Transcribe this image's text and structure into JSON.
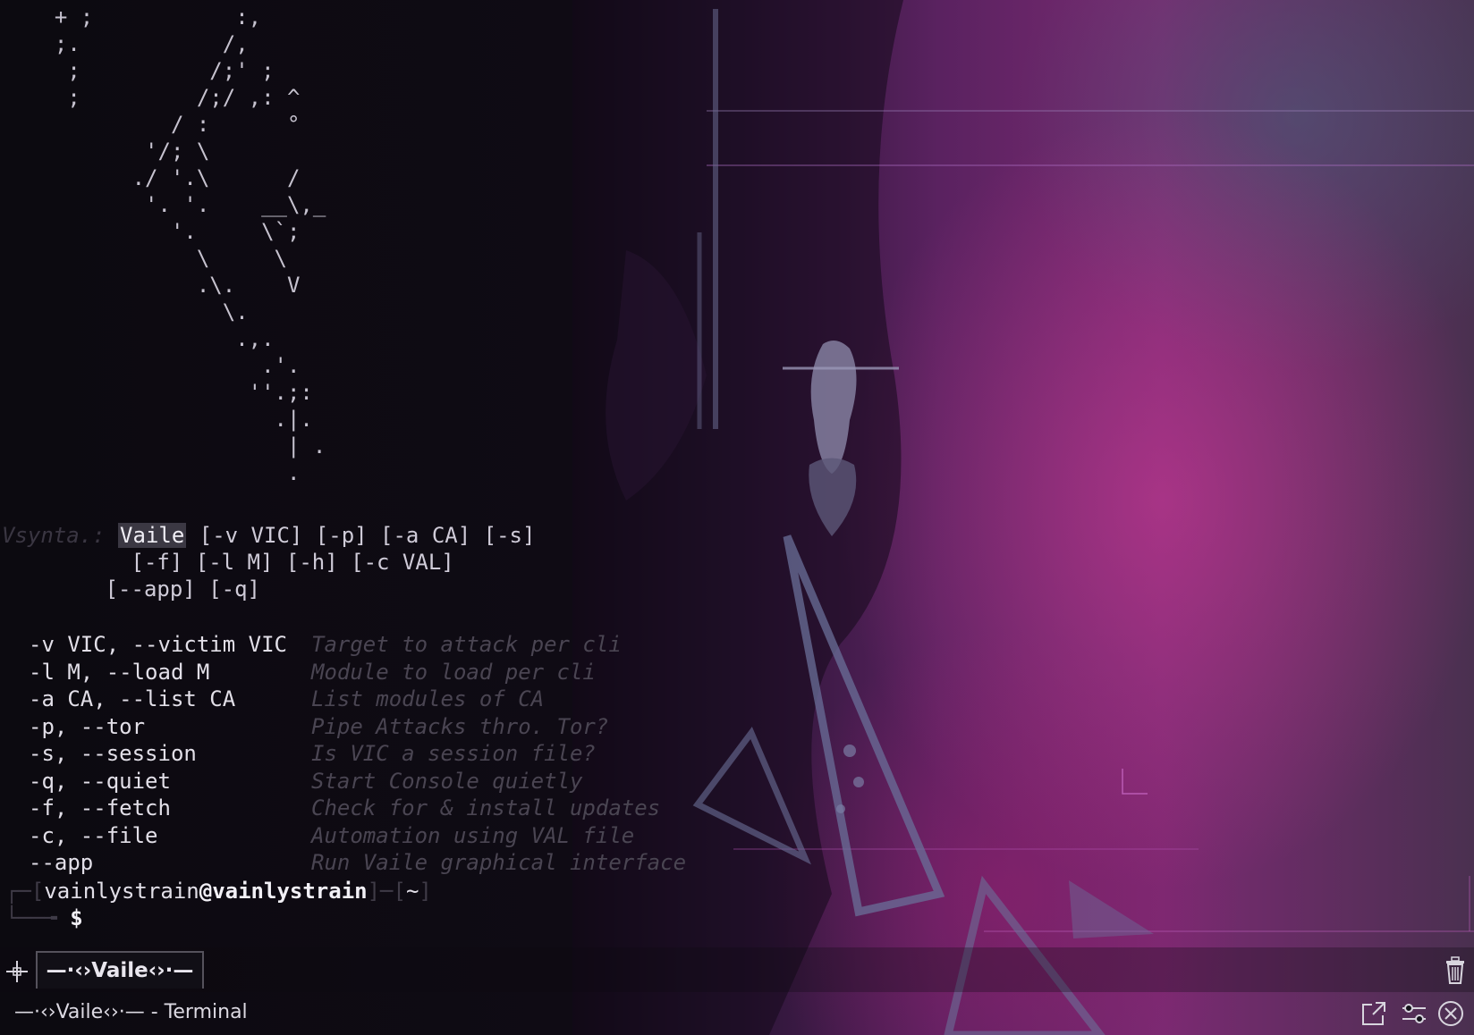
{
  "ascii_art": [
    "  + ;           :,",
    "  ;.           /,",
    "   ;          /;' ;",
    "   ;         /;/ ,: ^",
    "           / :      °",
    "         '/; \\",
    "        ./ '.\\      /",
    "         '. '.    __\\,_",
    "           '.     \\`;",
    "             \\     \\",
    "             .\\.    V",
    "               \\.",
    "                .,.",
    "                  .'.",
    "                 ''.;:",
    "                   .|.",
    "                    | .",
    "                    ."
  ],
  "usage": {
    "prefix": "Vsynta.:",
    "program": "Vaile",
    "line1_args": " [-v VIC] [-p] [-a CA] [-s]",
    "line2": "          [-f] [-l M] [-h] [-c VAL]",
    "line3": "        [--app] [-q]"
  },
  "options": [
    {
      "flag": "-v VIC, --victim VIC",
      "desc": "Target to attack per cli"
    },
    {
      "flag": "-l M, --load M",
      "desc": "Module to load per cli"
    },
    {
      "flag": "-a CA, --list CA",
      "desc": "List modules of CA"
    },
    {
      "flag": "-p, --tor",
      "desc": "Pipe Attacks thro. Tor?"
    },
    {
      "flag": "-s, --session",
      "desc": "Is VIC a session file?"
    },
    {
      "flag": "-q, --quiet",
      "desc": "Start Console quietly"
    },
    {
      "flag": "-f, --fetch",
      "desc": "Check for & install updates"
    },
    {
      "flag": "-c, --file",
      "desc": "Automation using VAL file"
    },
    {
      "flag": "--app",
      "desc": "Run Vaile graphical interface"
    }
  ],
  "prompt": {
    "corner_top": "┌─[",
    "user": "vainlystrain",
    "at_host": "@vainlystrain",
    "sep": "]─[",
    "cwd": "~",
    "end": "]",
    "corner_bottom": "└──╼ ",
    "symbol": "$"
  },
  "tabbar": {
    "new_tab_icon": "plus-icon",
    "active_tab_label": "—·‹›Vaile‹›·—",
    "trash_icon": "trash-icon"
  },
  "statusbar": {
    "window_title": "—·‹›Vaile‹›·— - Terminal",
    "icons": [
      "external-window-icon",
      "settings-sliders-icon",
      "close-circle-icon"
    ]
  },
  "colors": {
    "terminal_bg": "#0c0a10",
    "text": "#cfcbd8",
    "desc_text": "#4a4552",
    "wallpaper_magenta": "#7a2a72",
    "wallpaper_teal": "#465f78"
  }
}
